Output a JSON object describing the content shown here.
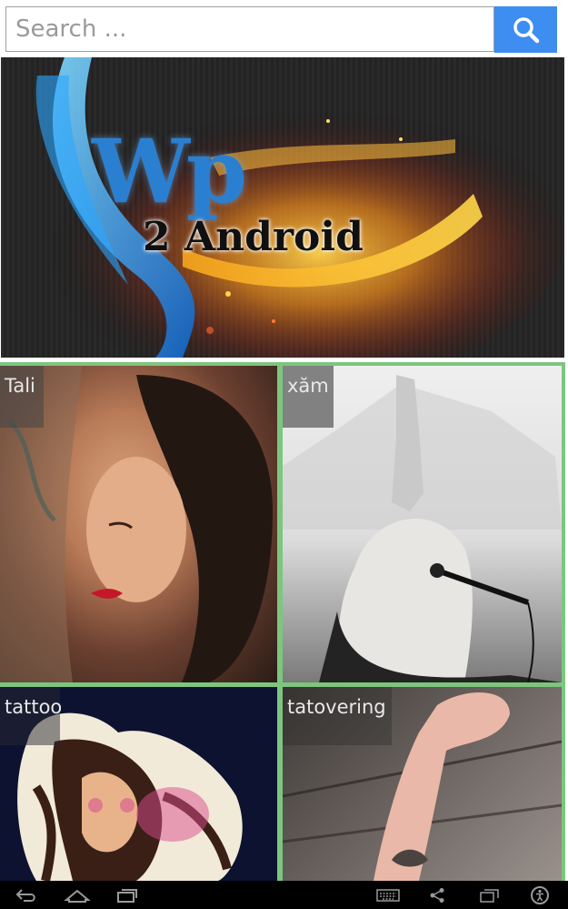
{
  "search": {
    "placeholder": "Search ...",
    "value": "",
    "button_icon": "search-icon"
  },
  "banner": {
    "logo_line1": "Wp",
    "logo_line2": "2 Android"
  },
  "categories": [
    {
      "label": "Tali"
    },
    {
      "label": "xăm"
    },
    {
      "label": "tattoo"
    },
    {
      "label": "tatovering"
    }
  ],
  "navbar": {
    "icons": [
      "back-icon",
      "home-icon",
      "recent-apps-icon",
      "keyboard-icon",
      "share-icon",
      "screen-icon",
      "accessibility-icon"
    ]
  },
  "colors": {
    "accent": "#3d8ef0",
    "grid_border": "#7cc67e",
    "navbar": "#000000"
  }
}
